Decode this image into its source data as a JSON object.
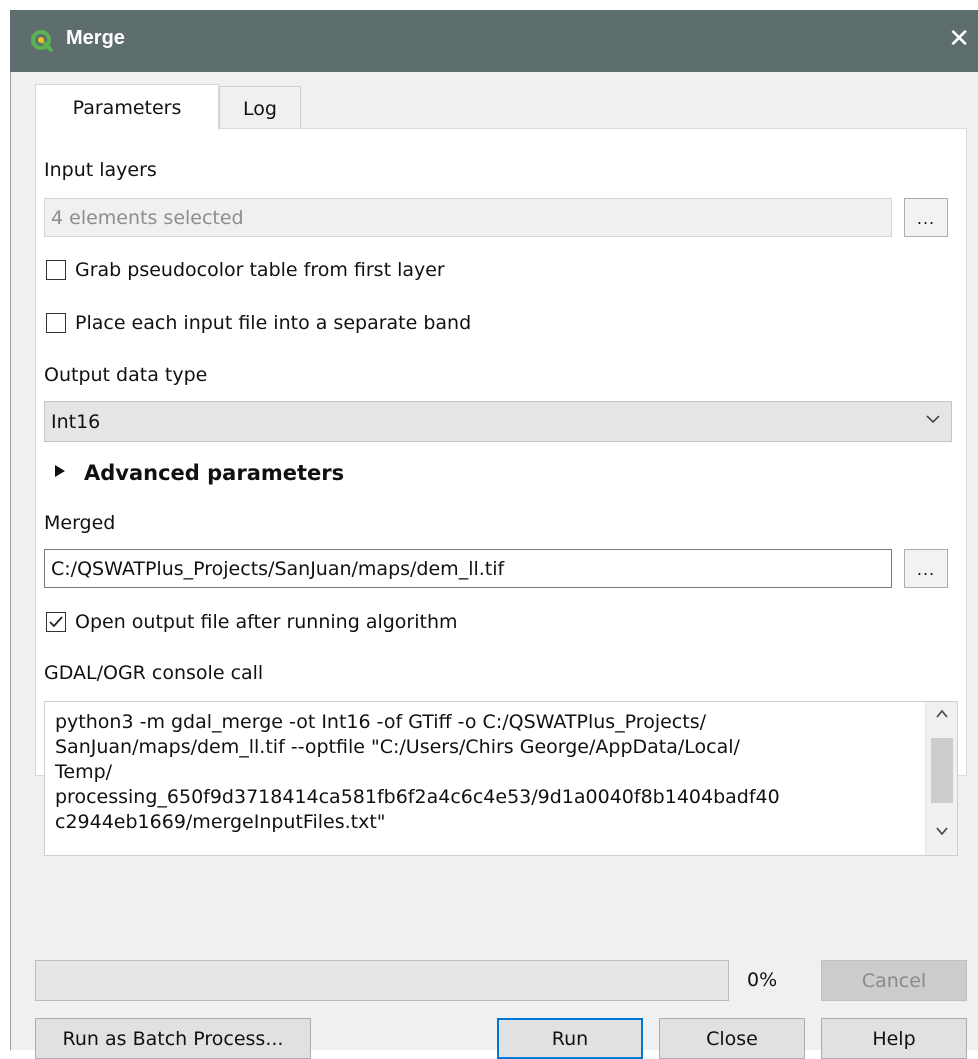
{
  "window": {
    "title": "Merge",
    "close_glyph": "✕"
  },
  "tabs": [
    {
      "label": "Parameters",
      "active": true
    },
    {
      "label": "Log",
      "active": false
    }
  ],
  "params": {
    "input_layers": {
      "label": "Input layers",
      "value": "4 elements selected",
      "browse_label": "..."
    },
    "grab_pseudocolor": {
      "label": "Grab pseudocolor table from first layer",
      "checked": false
    },
    "separate_band": {
      "label": "Place each input file into a separate band",
      "checked": false
    },
    "output_data_type": {
      "label": "Output data type",
      "value": "Int16"
    },
    "advanced": {
      "label": "Advanced parameters",
      "expanded": false
    },
    "merged": {
      "label": "Merged",
      "value": "C:/QSWATPlus_Projects/SanJuan/maps/dem_ll.tif",
      "browse_label": "..."
    },
    "open_output": {
      "label": "Open output file after running algorithm",
      "checked": true,
      "check_glyph": "✓"
    },
    "console": {
      "label": "GDAL/OGR console call",
      "text": "python3 -m gdal_merge -ot Int16 -of GTiff -o C:/QSWATPlus_Projects/\nSanJuan/maps/dem_ll.tif --optfile \"C:/Users/Chirs George/AppData/Local/\nTemp/\nprocessing_650f9d3718414ca581fb6f2a4c6c4e53/9d1a0040f8b1404badf40\nc2944eb1669/mergeInputFiles.txt\""
    }
  },
  "footer": {
    "progress_percent": 0,
    "progress_text": "0%",
    "cancel_label": "Cancel",
    "batch_label": "Run as Batch Process...",
    "run_label": "Run",
    "close_label": "Close",
    "help_label": "Help"
  },
  "colors": {
    "titlebar": "#5e6e6e",
    "default_button_border": "#0078d7",
    "qgis_green": "#59b353",
    "qgis_yellow": "#f0c31f"
  },
  "icons": {
    "app": "qgis-logo-icon",
    "close": "close-icon",
    "browse": "ellipsis-icon",
    "dropdown": "chevron-down-icon",
    "advanced": "triangle-right-icon",
    "scroll_up": "chevron-up-icon",
    "scroll_down": "chevron-down-icon"
  }
}
